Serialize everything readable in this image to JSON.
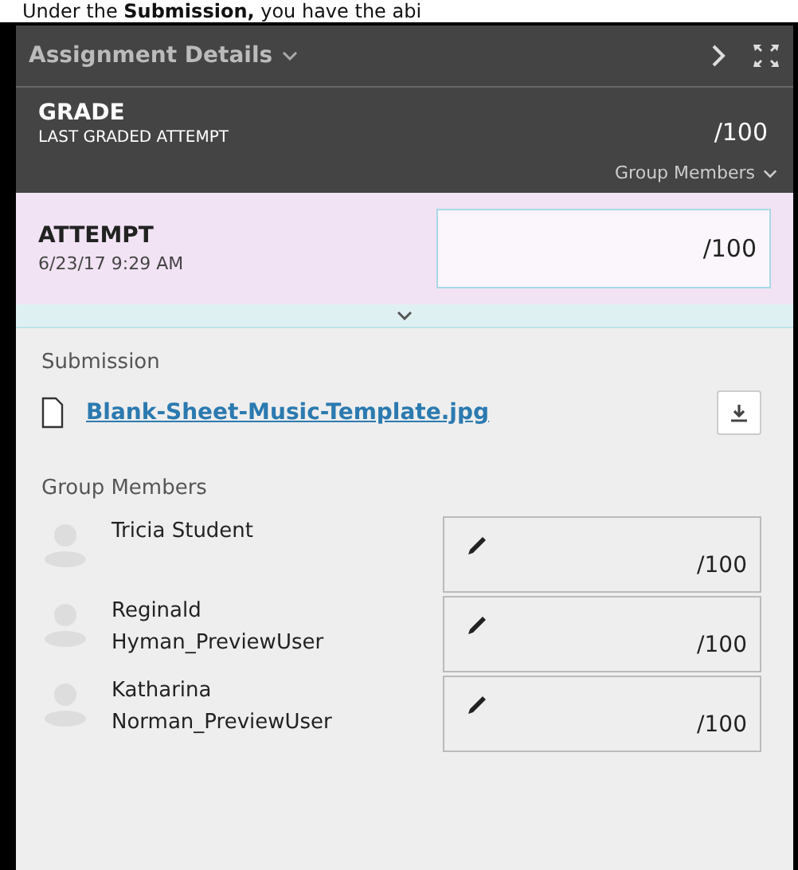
{
  "caption": "Under the **Submission,** you have the abi",
  "header": {
    "title": "Assignment Details"
  },
  "grade": {
    "label": "GRADE",
    "sublabel": "LAST GRADED ATTEMPT",
    "value": "/100",
    "toggle": "Group Members"
  },
  "attempt": {
    "label": "ATTEMPT",
    "date": "6/23/17 9:29 AM",
    "value": "/100"
  },
  "submission": {
    "heading": "Submission",
    "file": "Blank-Sheet-Music-Template.jpg"
  },
  "group": {
    "heading": "Group Members",
    "members": [
      {
        "name": "Tricia Student",
        "value": "/100"
      },
      {
        "name": "Reginald Hyman_PreviewUser",
        "value": "/100"
      },
      {
        "name": "Katharina Norman_PreviewUser",
        "value": "/100"
      }
    ]
  }
}
